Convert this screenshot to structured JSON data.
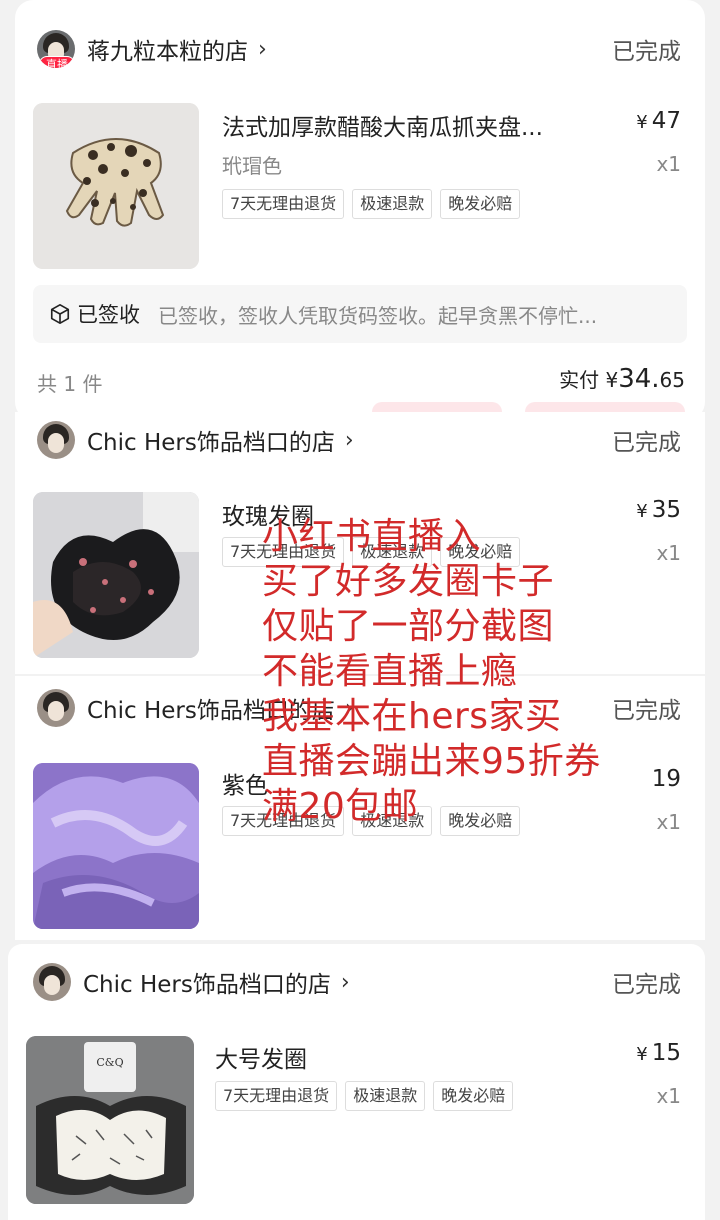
{
  "orders": [
    {
      "shop_name": "蒋九粒本粒的店",
      "live_badge": "直播",
      "status": "已完成",
      "product": {
        "name": "法式加厚款醋酸大南瓜抓夹盘...",
        "variant": "玳瑁色",
        "currency": "¥",
        "price": "47",
        "qty": "x1",
        "tags": [
          "7天无理由退货",
          "极速退款",
          "晚发必赔"
        ]
      },
      "logistics": {
        "label": "已签收",
        "desc": "已签收，签收人凭取货码签收。起早贪黑不停忙..."
      },
      "footer": {
        "count": "共 1 件",
        "paid_label": "实付",
        "currency": "¥",
        "amount_int": "34.",
        "amount_dec": "65"
      }
    },
    {
      "shop_name": "Chic Hers饰品档口的店",
      "status": "已完成",
      "product": {
        "name": "玫瑰发圈",
        "currency": "¥",
        "price": "35",
        "qty": "x1",
        "tags": [
          "7天无理由退货",
          "极速退款",
          "晚发必赔"
        ]
      }
    },
    {
      "shop_name": "Chic Hers饰品档口的店",
      "status": "已完成",
      "product": {
        "name": "紫色",
        "price": "19",
        "qty": "x1",
        "tags": [
          "7天无理由退货",
          "极速退款",
          "晚发必赔"
        ]
      }
    },
    {
      "shop_name": "Chic Hers饰品档口的店",
      "status": "已完成",
      "product": {
        "name": "大号发圈",
        "currency": "¥",
        "price": "15",
        "qty": "x1",
        "tags": [
          "7天无理由退货",
          "极速退款",
          "晚发必赔"
        ]
      }
    }
  ],
  "overlay_note": [
    "小红书直播入",
    "买了好多发圈卡子",
    "仅贴了一部分截图",
    "不能看直播上瘾",
    "我基本在hers家买",
    "直播会蹦出来95折券",
    "满20包邮"
  ],
  "colors": {
    "overlay_text": "#d22a2a",
    "live_badge": "#ff2442",
    "status_text": "#555555",
    "muted_text": "#888888"
  }
}
